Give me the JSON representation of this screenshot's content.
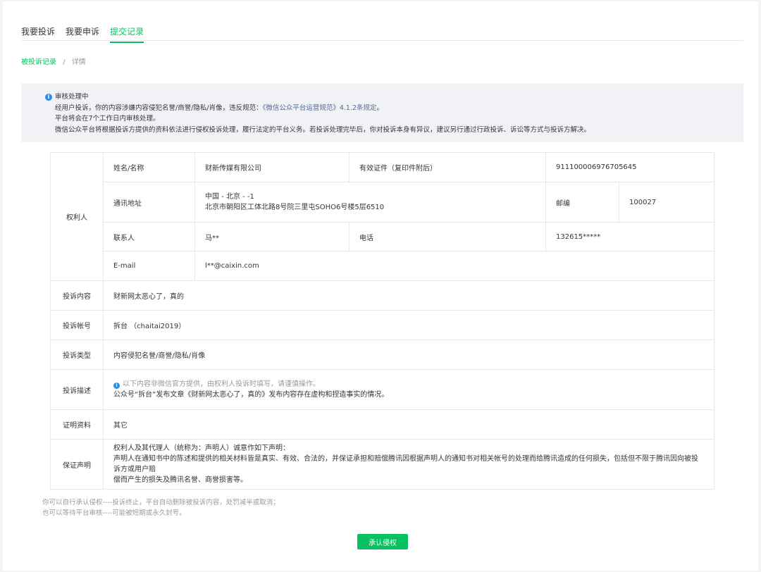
{
  "tabs": [
    {
      "label": "我要投诉",
      "active": false
    },
    {
      "label": "我要申诉",
      "active": false
    },
    {
      "label": "提交记录",
      "active": true
    }
  ],
  "breadcrumb": {
    "parent": "被投诉记录",
    "separator": "/",
    "current": "详情"
  },
  "notice": {
    "icon": "info-icon",
    "title": "审核处理中",
    "line1_prefix": "经用户投诉，你的内容涉嫌内容侵犯名誉/商誉/隐私/肖像，违反规范：",
    "line1_link": "《微信公众平台运营规范》4.1.2条规定",
    "line1_suffix": "。",
    "line2": "平台将会在7个工作日内审核处理。",
    "line3": "微信公众平台将根据投诉方提供的资料依法进行侵权投诉处理，履行法定的平台义务。若投诉处理完毕后，你对投诉本身有异议，建议另行通过行政投诉、诉讼等方式与投诉方解决。"
  },
  "details": {
    "rights_holder_label": "权利人",
    "name_label": "姓名/名称",
    "name_value": "财新传媒有限公司",
    "id_label": "有效证件（复印件附后）",
    "id_value": "911100006976705645",
    "address_label": "通讯地址",
    "address_line1": "中国 - 北京 - -1",
    "address_line2": "北京市朝阳区工体北路8号院三里屯SOHO6号楼5层6510",
    "postcode_label": "邮编",
    "postcode_value": "100027",
    "contact_label": "联系人",
    "contact_value": "马**",
    "phone_label": "电话",
    "phone_value": "132615*****",
    "email_label": "E-mail",
    "email_value": "l**@caixin.com",
    "content_label": "投诉内容",
    "content_value": "财新网太恶心了，真的",
    "account_label": "投诉帐号",
    "account_value": "拆台 （chaitai2019）",
    "type_label": "投诉类型",
    "type_value": "内容侵犯名誉/商誉/隐私/肖像",
    "desc_label": "投诉描述",
    "desc_hint": "以下内容非微信官方提供，由权利人投诉时填写，请谨慎操作。",
    "desc_value": "公众号“拆台”发布文章《财新网太恶心了，真的》发布内容存在虚构和捏造事实的情况。",
    "proof_label": "证明资料",
    "proof_value": "其它",
    "decl_label": "保证声明",
    "decl_line1": "权利人及其代理人（统称为：声明人）诚意作如下声明：",
    "decl_line2": "声明人在通知书中的陈述和提供的相关材料皆是真实、有效、合法的，并保证承担和赔偿腾讯因根据声明人的通知书对相关帐号的处理而给腾讯造成的任何损失，包括但不限于腾讯因向被投诉方或用户赔",
    "decl_line3": "偿而产生的损失及腾讯名誉、商誉损害等。"
  },
  "footer": {
    "line1": "你可以自行承认侵权----投诉终止，平台自动删除被投诉内容，处罚减半或取消；",
    "line2": "也可以等待平台审核----可能被短期或永久封号。"
  },
  "confirm_button": "承认侵权",
  "colors": {
    "accent": "#07c160",
    "link": "#576b95",
    "info": "#2c8ce8"
  }
}
